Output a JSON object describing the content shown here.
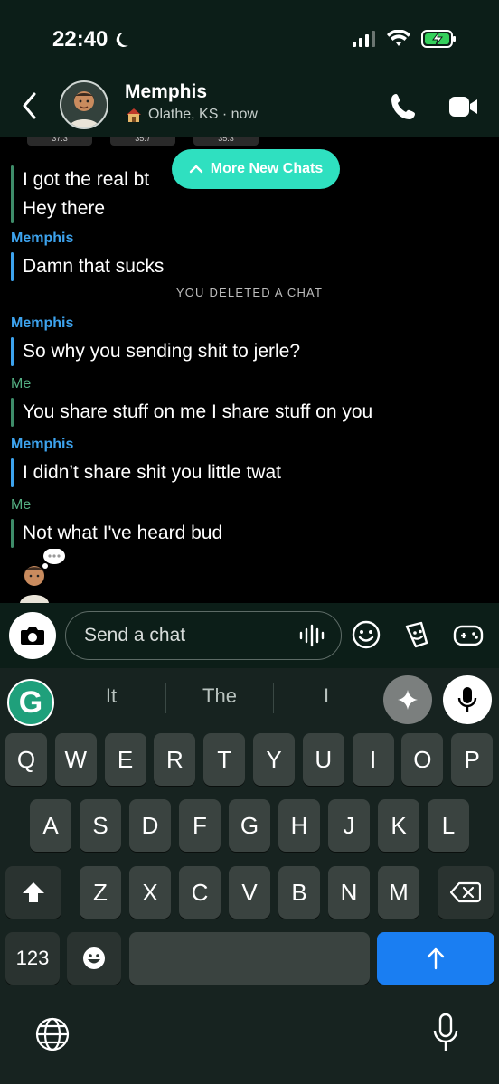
{
  "status_bar": {
    "time": "22:40"
  },
  "header": {
    "contact_name": "Memphis",
    "location": "Olathe, KS · now"
  },
  "chat": {
    "stats": [
      "37.3",
      "35.7",
      "35.3"
    ],
    "more_chats_label": "More New Chats",
    "first_block_lines": [
      "I got the real bt",
      "Hey there"
    ],
    "system_note": "YOU DELETED A CHAT",
    "messages": [
      {
        "sender": "Memphis",
        "text": "Damn that sucks"
      },
      {
        "sender": "Memphis",
        "text": "So why you sending shit to jerle?"
      },
      {
        "sender": "Me",
        "text": "You share stuff on me I share stuff on you"
      },
      {
        "sender": "Memphis",
        "text": "I didn’t share shit you little twat"
      },
      {
        "sender": "Me",
        "text": "Not what I've heard bud"
      }
    ]
  },
  "composer": {
    "placeholder": "Send a chat"
  },
  "keyboard": {
    "suggestions": [
      "It",
      "The",
      "I"
    ],
    "row1": [
      "Q",
      "W",
      "E",
      "R",
      "T",
      "Y",
      "U",
      "I",
      "O",
      "P"
    ],
    "row2": [
      "A",
      "S",
      "D",
      "F",
      "G",
      "H",
      "J",
      "K",
      "L"
    ],
    "row3": [
      "Z",
      "X",
      "C",
      "V",
      "B",
      "N",
      "M"
    ],
    "numbers_key": "123",
    "grammarly_logo": "G"
  },
  "colors": {
    "accent_teal": "#2fe0c0",
    "memphis_blue": "#3da3ee",
    "me_green": "#55b184",
    "return_blue": "#1a7ef2"
  }
}
